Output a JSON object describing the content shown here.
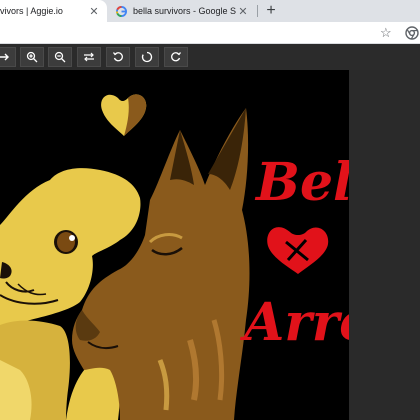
{
  "tabs": [
    {
      "title": "vivors | Aggie.io",
      "close_icon": "close-icon"
    },
    {
      "title": "bella survivors - Google Search",
      "close_icon": "close-icon",
      "favicon": "google-g-icon"
    }
  ],
  "new_tab_icon": "plus-icon",
  "omnibar": {
    "bookmark_icon": "star-icon",
    "profile_icon": "chrome-icon"
  },
  "toolbar": {
    "buttons": [
      {
        "name": "next-icon"
      },
      {
        "name": "zoom-in-icon"
      },
      {
        "name": "zoom-out-icon"
      },
      {
        "name": "flip-icon"
      },
      {
        "name": "rotate-left-icon"
      },
      {
        "name": "reset-icon"
      },
      {
        "name": "rotate-right-icon"
      }
    ]
  },
  "artwork": {
    "text_top": "Bella",
    "text_bottom": "Arrow",
    "colors": {
      "red": "#e1121a",
      "yellow": "#e8c94b",
      "brown": "#8a5a1c",
      "dark_brown": "#5a3a10",
      "background": "#000000"
    }
  }
}
